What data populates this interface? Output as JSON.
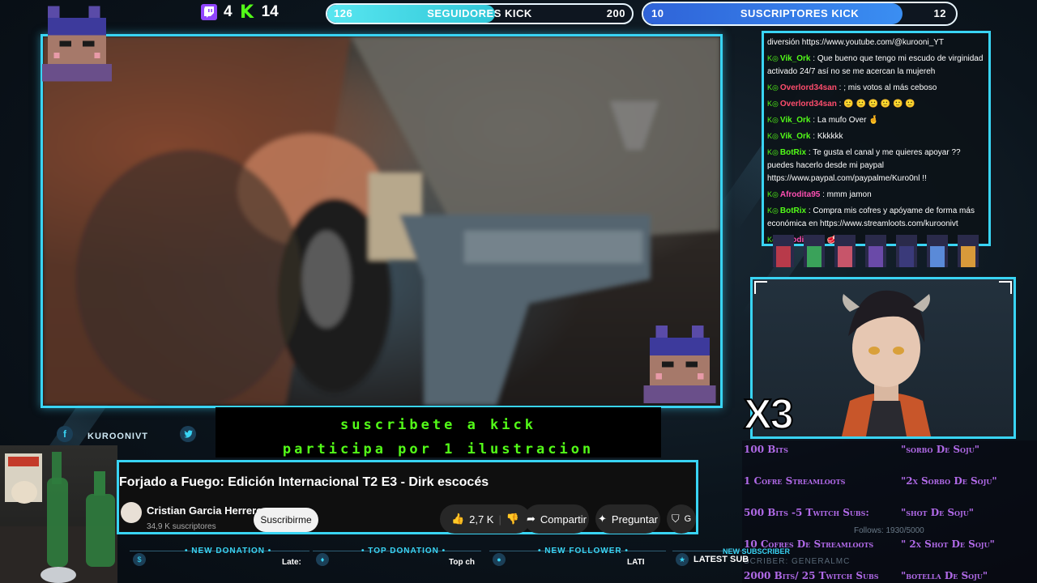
{
  "counters": {
    "twitch_count": "4",
    "kick_count": "14"
  },
  "goals": {
    "followers": {
      "start": "126",
      "label": "SEGUIDORES KICK",
      "target": "200",
      "fill": 0.55
    },
    "subs": {
      "start": "10",
      "label": "SUSCRIPTORES KICK",
      "target": "12",
      "fill": 0.83
    }
  },
  "socials": {
    "facebook_handle": "KUROONIVT"
  },
  "banner": {
    "line1": "suscribete a kick",
    "line2": "participa por 1 ilustracion"
  },
  "youtube": {
    "title": "Forjado a Fuego: Edición Internacional T2 E3 - Dirk escocés",
    "channel": "Cristian Garcia Herrero",
    "subs": "34,9 K suscriptores",
    "subscribe": "Suscribirme",
    "likes": "2,7 K",
    "share": "Compartir",
    "ask": "Preguntar",
    "save_cut": "G"
  },
  "multiplier": "X3",
  "chat": {
    "messages": [
      {
        "user": "",
        "text": "diversión https://www.youtube.com/@kurooni_YT",
        "color": "#ffffff"
      },
      {
        "user": "Vik_Ork",
        "text": ": Que bueno que tengo mi escudo de virginidad activado 24/7 así no se me acercan la mujereh",
        "color": "#53fc18"
      },
      {
        "user": "Overlord34san",
        "text": ": ; mis votos al más ceboso",
        "color": "#ff4d6d"
      },
      {
        "user": "Overlord34san",
        "text": ": 🙂 🙂 🙂 🙂 🙂 🙂",
        "color": "#ff4d6d"
      },
      {
        "user": "Vik_Ork",
        "text": ": La mufo Over 🤞",
        "color": "#53fc18"
      },
      {
        "user": "Vik_Ork",
        "text": ": Kkkkkk",
        "color": "#53fc18"
      },
      {
        "user": "BotRix",
        "text": ": Te gusta el canal y me quieres apoyar ?? puedes hacerlo desde mi paypal https://www.paypal.com/paypalme/Kuro0nl !!",
        "color": "#53fc18"
      },
      {
        "user": "Afrodita95",
        "text": ": mmm jamon",
        "color": "#ff4fb3"
      },
      {
        "user": "BotRix",
        "text": ": Compra mis cofres y apóyame de forma más económica en https://www.streamloots.com/kuroonivt",
        "color": "#53fc18"
      },
      {
        "user": "Afrodita95",
        "text": ": 🥩",
        "color": "#ff4fb3"
      },
      {
        "user": "",
        "text": "...dit ... ar m...",
        "color": "#ffffff"
      }
    ]
  },
  "rewards": [
    {
      "left": "100 Bits",
      "right": "\"sorbo De Soju\""
    },
    {
      "left": "1 Cofre Streamloots",
      "right": "\"2x Sorbo De Soju\""
    },
    {
      "left": "500 Bits -5 Twitch Subs:",
      "right": "\"shot De Soju\""
    },
    {
      "left": "10 Cofres De Streamloots",
      "right": "\" 2x Shot De Soju\""
    },
    {
      "left": "2000 Bits/ 25 Twitch Subs",
      "right": "\"botella De Soju\""
    }
  ],
  "follows_overlay": "Follows: 1930/5000",
  "subscriber_overlay": "SCRIBER: GENERALMC",
  "ticker": {
    "donation_label": "• NEW DONATION •",
    "donation_val": "Late:",
    "top_label": "• TOP DONATION •",
    "top_val": "Top ch",
    "follower_label": "• NEW FOLLOWER •",
    "follower_val": "LATI",
    "sub_label": "LATEST SUB",
    "new_sub_cut": "NEW SUBSCRIBER"
  },
  "colors": {
    "accent": "#39d4f4",
    "kick_green": "#53fc18",
    "reward_purple": "#b16ae8"
  }
}
